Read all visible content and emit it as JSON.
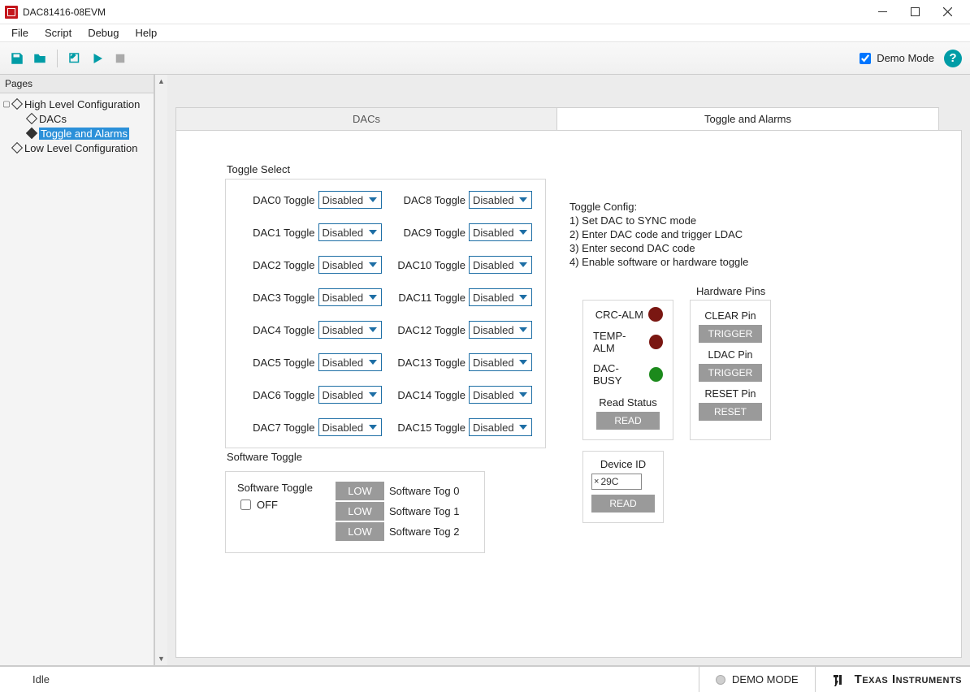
{
  "window": {
    "title": "DAC81416-08EVM"
  },
  "menu": {
    "file": "File",
    "script": "Script",
    "debug": "Debug",
    "help": "Help"
  },
  "toolbar": {
    "demo_mode_label": "Demo Mode",
    "demo_mode_checked": true
  },
  "sidebar": {
    "header": "Pages",
    "tree": {
      "high": "High Level Configuration",
      "dacs": "DACs",
      "toggle": "Toggle and Alarms",
      "low": "Low Level Configuration"
    }
  },
  "tabs": {
    "dacs": "DACs",
    "toggle": "Toggle and Alarms"
  },
  "toggle_select": {
    "title": "Toggle Select",
    "items": [
      {
        "label": "DAC0 Toggle",
        "value": "Disabled"
      },
      {
        "label": "DAC1 Toggle",
        "value": "Disabled"
      },
      {
        "label": "DAC2 Toggle",
        "value": "Disabled"
      },
      {
        "label": "DAC3 Toggle",
        "value": "Disabled"
      },
      {
        "label": "DAC4 Toggle",
        "value": "Disabled"
      },
      {
        "label": "DAC5 Toggle",
        "value": "Disabled"
      },
      {
        "label": "DAC6 Toggle",
        "value": "Disabled"
      },
      {
        "label": "DAC7 Toggle",
        "value": "Disabled"
      },
      {
        "label": "DAC8 Toggle",
        "value": "Disabled"
      },
      {
        "label": "DAC9 Toggle",
        "value": "Disabled"
      },
      {
        "label": "DAC10 Toggle",
        "value": "Disabled"
      },
      {
        "label": "DAC11 Toggle",
        "value": "Disabled"
      },
      {
        "label": "DAC12 Toggle",
        "value": "Disabled"
      },
      {
        "label": "DAC13 Toggle",
        "value": "Disabled"
      },
      {
        "label": "DAC14 Toggle",
        "value": "Disabled"
      },
      {
        "label": "DAC15 Toggle",
        "value": "Disabled"
      }
    ]
  },
  "toggle_config": {
    "header": "Toggle Config:",
    "line1": "1) Set DAC to SYNC mode",
    "line2": "2) Enter DAC code and trigger LDAC",
    "line3": "3) Enter second DAC code",
    "line4": "4) Enable software or hardware toggle"
  },
  "alarms": {
    "crc": "CRC-ALM",
    "temp": "TEMP-ALM",
    "busy": "DAC-BUSY",
    "read_status": "Read Status",
    "read_btn": "READ"
  },
  "hw_pins": {
    "title": "Hardware Pins",
    "clear": "CLEAR Pin",
    "ldac": "LDAC Pin",
    "reset": "RESET Pin",
    "trigger_btn": "TRIGGER",
    "reset_btn": "RESET"
  },
  "software_toggle": {
    "title": "Software Toggle",
    "label": "Software Toggle",
    "off": "OFF",
    "low_btn": "LOW",
    "tog0": "Software Tog 0",
    "tog1": "Software Tog 1",
    "tog2": "Software Tog 2"
  },
  "device_id": {
    "title": "Device ID",
    "value": "29C",
    "read_btn": "READ"
  },
  "statusbar": {
    "idle": "Idle",
    "mode": "DEMO MODE",
    "brand": "Texas Instruments"
  }
}
